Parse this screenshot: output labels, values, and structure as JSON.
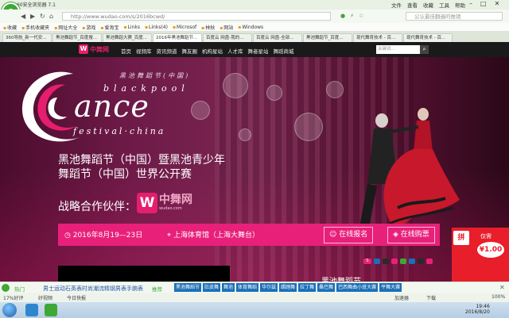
{
  "browser": {
    "title": "360安全浏览器 7.1",
    "menu": [
      "文件",
      "查看",
      "收藏",
      "工具",
      "帮助"
    ],
    "url": "http://www.wudao.com/s/2016bcwd/",
    "search_placeholder": "公认最佳翻遍的推销",
    "bookmarks": [
      "收藏",
      "手机收藏夹",
      "网址大全",
      "游戏",
      "爱淘宝",
      "Links",
      "Links(4)",
      "Microsof",
      "林秋",
      "网站",
      "Windows"
    ],
    "tabs": [
      "360导航_新一代安...",
      "黑池舞蹈节_百度搜...",
      "黑池舞蹈大赛_百度...",
      "2016年黑池舞蹈节...",
      "百度云 网盘-我的...",
      "百度云 网盘-全部...",
      "黑池舞蹈节_百度...",
      "现代舞育技术 - 百...",
      "现代舞育技术 - 百..."
    ]
  },
  "site": {
    "logo_text": "中舞网",
    "menu": [
      "首页",
      "视频库",
      "资讯频道",
      "舞友圈",
      "机构星站",
      "人才库",
      "舞者星站",
      "舞蹈商城"
    ],
    "search_placeholder": "关键词...",
    "search_icon": "search-icon"
  },
  "hero": {
    "brand_cn": "黑池舞蹈节(中国)",
    "brand_blackpool": "blackpool",
    "brand_dance": "ance",
    "brand_festival": "festival·china",
    "headline_line1": "黑池舞蹈节（中国）暨黑池青少年",
    "headline_line2": "舞蹈节（中国）世界公开赛",
    "partner_label": "战略合作伙伴：",
    "partner_logo": "中舞网",
    "partner_logo_sub": "wudao.com",
    "date": "2016年8月19—23日",
    "venue": "上海体育馆（上海大舞台）",
    "signup_label": "在线报名",
    "tickets_label": "在线购票",
    "section_title": "黑池舞蹈节"
  },
  "promo": {
    "badge": "拼",
    "label": "仅需",
    "price": "¥1.00"
  },
  "ticker": {
    "hot_label": "热门",
    "news": "男士运动石英表时尚潮流精钢男表手腕表",
    "rec_label": "推荐",
    "tags": [
      "黑池舞蹈节",
      "肚皮舞",
      "舞池",
      "体育舞蹈",
      "华尔兹",
      "踢踏舞",
      "拉丁舞",
      "桑巴舞",
      "巴西舞曲小班大赛",
      "平舞大赛"
    ]
  },
  "status": {
    "left": "17%好评",
    "mid": "好视频",
    "mid2": "今日快报",
    "speed": "加速器",
    "download": "下载",
    "zoom": "100%"
  },
  "taskbar": {
    "time": "19:46",
    "date": "2016/8/20"
  }
}
